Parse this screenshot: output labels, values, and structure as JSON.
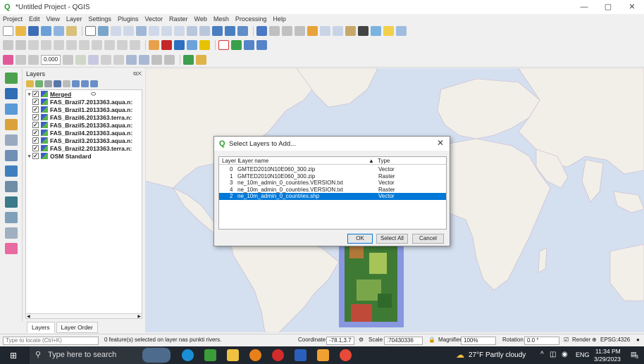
{
  "window": {
    "title": "*Untitled Project - QGIS",
    "controls": [
      "—",
      "▢",
      "✕"
    ]
  },
  "menu": [
    "Project",
    "Edit",
    "View",
    "Layer",
    "Settings",
    "Plugins",
    "Vector",
    "Raster",
    "Web",
    "Mesh",
    "Processing",
    "Help"
  ],
  "toolbar3": {
    "opacity_value": "0.000"
  },
  "layers_panel": {
    "title": "Layers",
    "items": [
      {
        "name": "Merged",
        "group": true
      },
      {
        "name": "FAS_Brazil7.2013363.aqua.n:"
      },
      {
        "name": "FAS_Brazil1.2013363.aqua.n:"
      },
      {
        "name": "FAS_Brazil6.2013363.terra.n:"
      },
      {
        "name": "FAS_Brazil5.2013363.aqua.n:"
      },
      {
        "name": "FAS_Brazil4.2013363.aqua.n:"
      },
      {
        "name": "FAS_Brazil3.2013363.aqua.n:"
      },
      {
        "name": "FAS_Brazil2.2013363.terra.n:"
      },
      {
        "name": "OSM Standard"
      }
    ],
    "tabs": [
      "Layers",
      "Layer Order"
    ]
  },
  "dialog": {
    "title": "Select Layers to Add...",
    "columns": [
      "Layer I",
      "Layer name",
      "Type"
    ],
    "rows": [
      {
        "id": "0",
        "name": "GMTED2010N10E060_300.zip",
        "type": "Vector",
        "selected": false
      },
      {
        "id": "1",
        "name": "GMTED2010N10E060_300.zip",
        "type": "Raster",
        "selected": false
      },
      {
        "id": "3",
        "name": "ne_10m_admin_0_countries.VERSION.txt",
        "type": "Vector",
        "selected": false
      },
      {
        "id": "4",
        "name": "ne_10m_admin_0_countries.VERSION.txt",
        "type": "Raster",
        "selected": false
      },
      {
        "id": "2",
        "name": "ne_10m_admin_0_countries.shp",
        "type": "Vector",
        "selected": true
      }
    ],
    "buttons": {
      "ok": "OK",
      "select_all": "Select All",
      "cancel": "Cancel"
    }
  },
  "statusbar": {
    "locate_placeholder": "Type to locate (Ctrl+K)",
    "message": "0 feature(s) selected on layer nas punkti rivers.",
    "coordinate_label": "Coordinate",
    "coordinate_value": "-78.1,3.7",
    "scale_label": "Scale",
    "scale_value": ":70430336",
    "magnifier_label": "Magnifier",
    "magnifier_value": "100%",
    "rotation_label": "Rotation",
    "rotation_value": "0.0 °",
    "render_label": "Render",
    "crs": "EPSG:4326"
  },
  "taskbar": {
    "search_placeholder": "Type here to search",
    "weather": "27°F  Partly cloudy",
    "lang": "ENG",
    "time": "11:34 PM",
    "date": "3/29/2023",
    "notifications": "3"
  },
  "colors": {
    "selection": "#0078d7",
    "ocean": "#d4dff0",
    "land": "#f2efe9",
    "taskbar": "#20262e"
  }
}
